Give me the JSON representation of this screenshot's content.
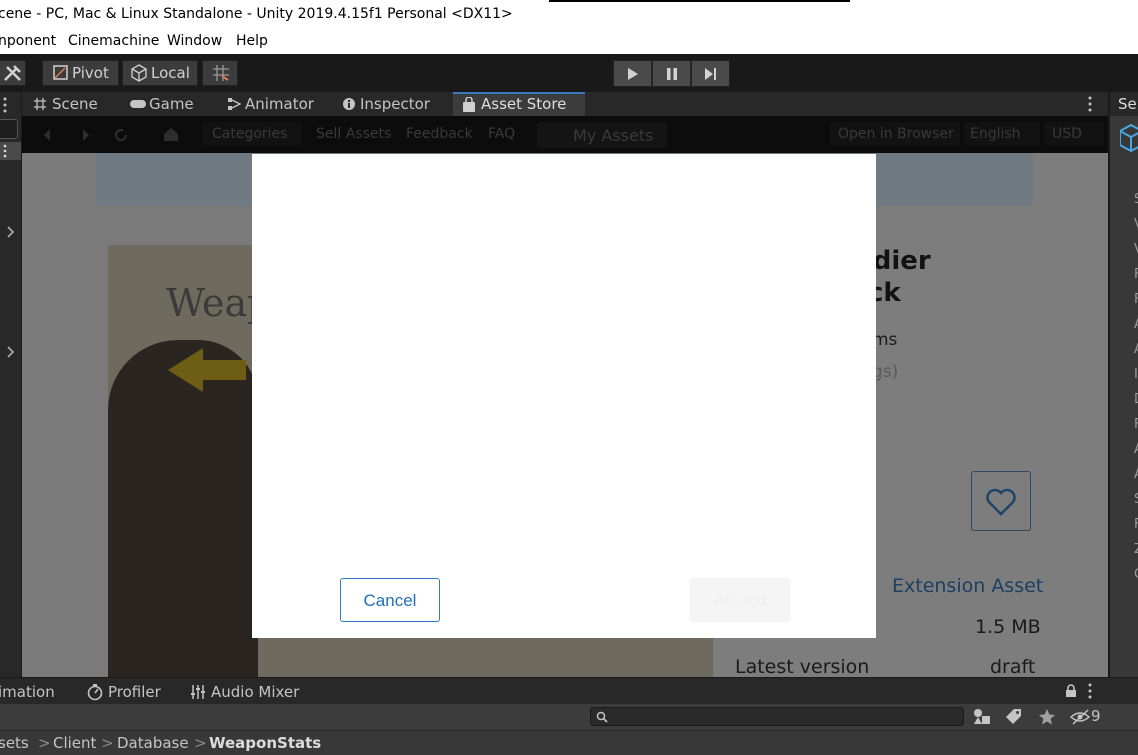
{
  "window": {
    "title": "cene - PC, Mac & Linux Standalone - Unity 2019.4.15f1 Personal <DX11>"
  },
  "menu": {
    "items": [
      "nponent",
      "Cinemachine",
      "Window",
      "Help"
    ]
  },
  "toolbar": {
    "pivot_label": "Pivot",
    "local_label": "Local",
    "play_icon": "play-icon",
    "pause_icon": "pause-icon",
    "step_icon": "step-icon"
  },
  "tabs": {
    "items": [
      {
        "label": "Scene",
        "icon": "hash-icon"
      },
      {
        "label": "Game",
        "icon": "gamepad-icon"
      },
      {
        "label": "Animator",
        "icon": "animator-icon"
      },
      {
        "label": "Inspector",
        "icon": "info-icon"
      },
      {
        "label": "Asset Store",
        "icon": "bag-icon",
        "active": true
      }
    ]
  },
  "right_panel": {
    "tab_label": "Se"
  },
  "store_nav": {
    "categories": "Categories",
    "sell_assets": "Sell Assets",
    "feedback": "Feedback",
    "faq": "FAQ",
    "my_assets": "My Assets",
    "open_in_browser": "Open in Browser",
    "language": "English",
    "currency": "USD"
  },
  "store_page": {
    "title_line1": "oldier",
    "title_line2": "ck",
    "sub1": "ms",
    "sub2": "gs)",
    "hero_text": "Weap",
    "asset_type": "Extension Asset",
    "file_size": "1.5 MB",
    "latest_version_label": "Latest version",
    "latest_version_value": "draft"
  },
  "dialog": {
    "cancel_label": "Cancel",
    "accept_label": "Accept"
  },
  "bottom_tabs": {
    "animation": "imation",
    "profiler": "Profiler",
    "audio_mixer": "Audio Mixer"
  },
  "project": {
    "hidden_count": "9",
    "breadcrumb": [
      "sets",
      "Client",
      "Database",
      "WeaponStats"
    ]
  },
  "colors": {
    "accent_blue": "#3a79bb",
    "dialog_button_blue": "#1f6fb6"
  }
}
